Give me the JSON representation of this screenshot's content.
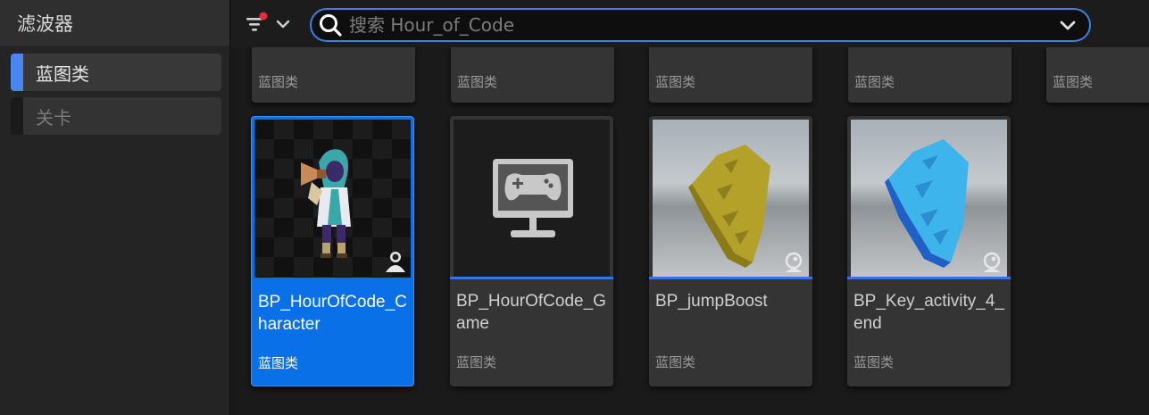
{
  "sidebar": {
    "title": "滤波器",
    "items": [
      {
        "label": "蓝图类",
        "active": true,
        "color": "#4a86f0"
      },
      {
        "label": "关卡",
        "active": false
      }
    ]
  },
  "toolbar": {
    "filter_icon": "filter-lines-icon",
    "search_placeholder": "搜索 Hour_of_Code",
    "search_value": ""
  },
  "colors": {
    "accent": "#3a73e8",
    "selected": "#0a70e8"
  },
  "top_row": {
    "type_labels": [
      "蓝图类",
      "蓝图类",
      "蓝图类",
      "蓝图类",
      "蓝图类"
    ]
  },
  "assets": [
    {
      "name": "BP_HourOfCode_Character",
      "type": "蓝图类",
      "selected": true,
      "badge": "character-icon"
    },
    {
      "name": "BP_HourOfCode_Game",
      "type": "蓝图类",
      "selected": false,
      "badge": ""
    },
    {
      "name": "BP_jumpBoost",
      "type": "蓝图类",
      "selected": false,
      "badge": "actor-icon"
    },
    {
      "name": "BP_Key_activity_4_end",
      "type": "蓝图类",
      "selected": false,
      "badge": "actor-icon"
    }
  ]
}
